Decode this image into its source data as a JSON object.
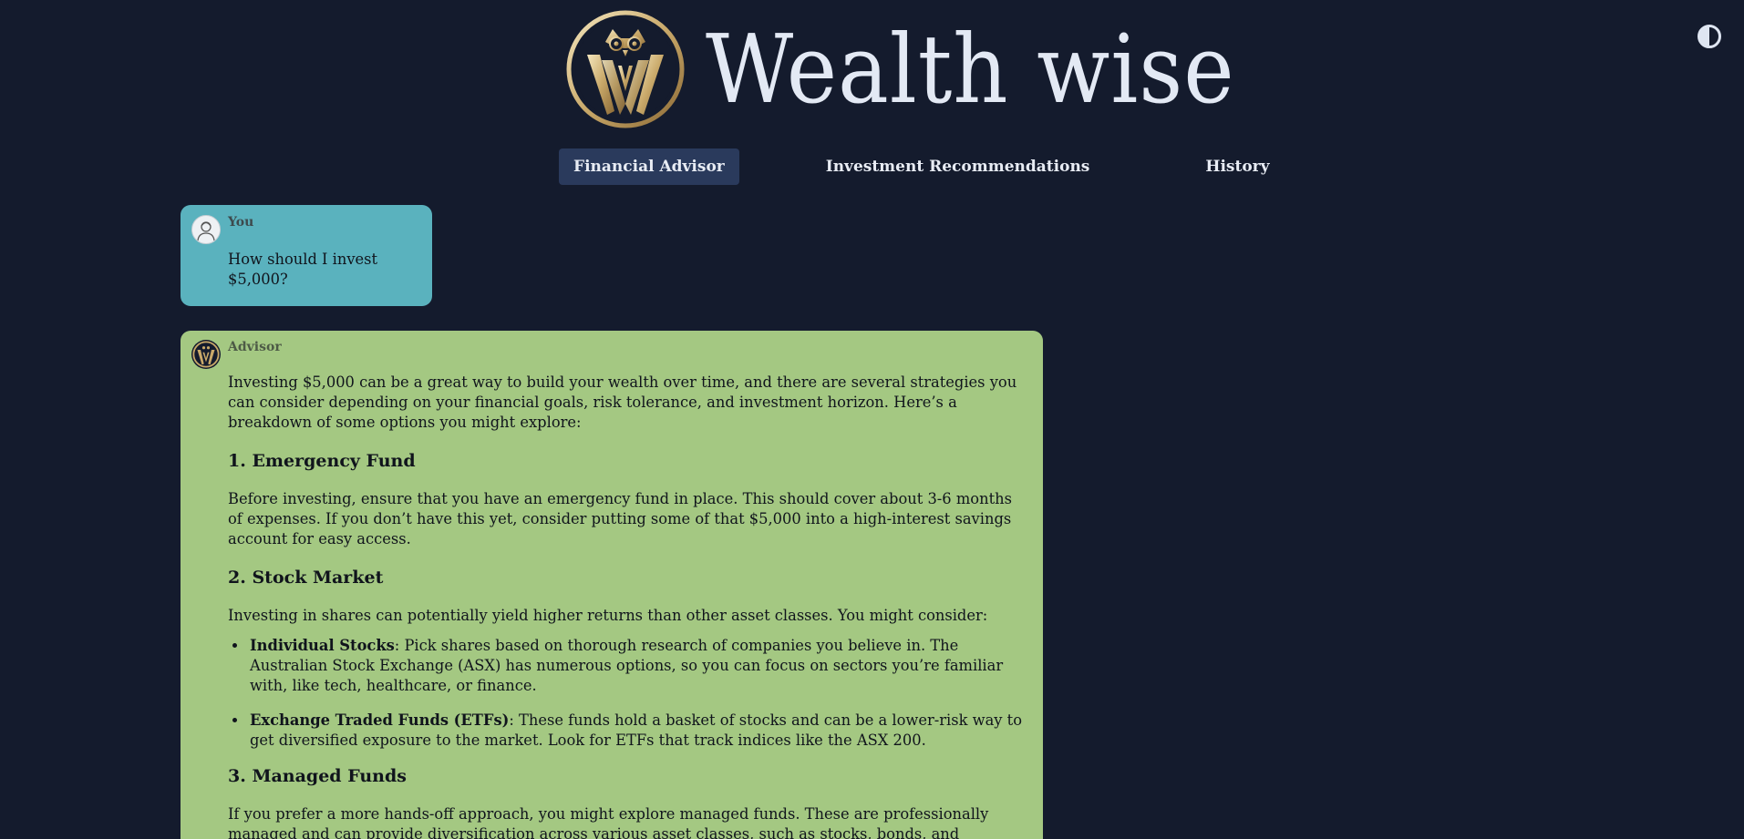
{
  "app": {
    "brand": "Wealth wise"
  },
  "nav": {
    "tabs": [
      {
        "label": "Financial Advisor",
        "active": true
      },
      {
        "label": "Investment Recommendations",
        "active": false
      },
      {
        "label": "History",
        "active": false
      }
    ]
  },
  "colors": {
    "background": "#141b2d",
    "user_bubble": "#5ab2be",
    "advisor_bubble": "#a4c882",
    "active_tab": "#2a3a5c",
    "logo_gold": "#c9a96a"
  },
  "icons": {
    "theme_toggle": "half-circle-contrast-icon",
    "logo": "owl-w-emblem",
    "user_avatar": "person-avatar-icon",
    "advisor_avatar": "owl-w-emblem"
  },
  "messages": {
    "user": {
      "sender": "You",
      "text": "How should I invest $5,000?"
    },
    "advisor": {
      "sender": "Advisor",
      "intro": "Investing $5,000 can be a great way to build your wealth over time, and there are several strategies you can consider depending on your financial goals, risk tolerance, and investment horizon. Here’s a breakdown of some options you might explore:",
      "section1": {
        "heading": "1. Emergency Fund",
        "text": "Before investing, ensure that you have an emergency fund in place. This should cover about 3-6 months of expenses. If you don’t have this yet, consider putting some of that $5,000 into a high-interest savings account for easy access."
      },
      "section2": {
        "heading": "2. Stock Market",
        "text": "Investing in shares can potentially yield higher returns than other asset classes. You might consider:",
        "bullets": [
          {
            "term": "Individual Stocks",
            "text": ": Pick shares based on thorough research of companies you believe in. The Australian Stock Exchange (ASX) has numerous options, so you can focus on sectors you’re familiar with, like tech, healthcare, or finance."
          },
          {
            "term": "Exchange Traded Funds (ETFs)",
            "text": ": These funds hold a basket of stocks and can be a lower-risk way to get diversified exposure to the market. Look for ETFs that track indices like the ASX 200."
          }
        ]
      },
      "section3": {
        "heading": "3. Managed Funds",
        "text": "If you prefer a more hands-off approach, you might explore managed funds. These are professionally managed and can provide diversification across various asset classes, such as stocks, bonds, and property."
      }
    }
  }
}
